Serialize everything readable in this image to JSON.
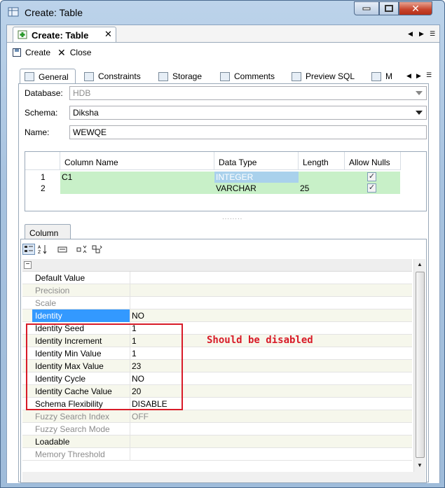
{
  "window": {
    "title": "Create: Table"
  },
  "editor_tab": {
    "label": "Create: Table",
    "close": "✕"
  },
  "toolbar": {
    "create_label": "Create",
    "close_label": "Close"
  },
  "subtabs": [
    "General",
    "Constraints",
    "Storage",
    "Comments",
    "Preview SQL",
    "M"
  ],
  "form": {
    "database_label": "Database:",
    "database_value": "HDB",
    "schema_label": "Schema:",
    "schema_value": "Diksha",
    "name_label": "Name:",
    "name_value": "WEWQE"
  },
  "columns_table": {
    "headers": [
      "Column Name",
      "Data Type",
      "Length",
      "Allow Nulls"
    ],
    "rows": [
      {
        "num": "1",
        "name": "C1",
        "type": "INTEGER",
        "length": "",
        "allow_nulls": true
      },
      {
        "num": "2",
        "name": "",
        "type": "VARCHAR",
        "length": "25",
        "allow_nulls": true
      }
    ]
  },
  "column_tab": {
    "label": "Column"
  },
  "properties": [
    {
      "name": "Default Value",
      "value": "",
      "disabled": false
    },
    {
      "name": "Precision",
      "value": "",
      "disabled": true
    },
    {
      "name": "Scale",
      "value": "",
      "disabled": true
    },
    {
      "name": "Identity",
      "value": "NO",
      "disabled": false,
      "selected": true
    },
    {
      "name": "Identity Seed",
      "value": "1",
      "disabled": false
    },
    {
      "name": "Identity Increment",
      "value": "1",
      "disabled": false
    },
    {
      "name": "Identity Min Value",
      "value": "1",
      "disabled": false
    },
    {
      "name": "Identity Max Value",
      "value": "23",
      "disabled": false
    },
    {
      "name": "Identity Cycle",
      "value": "NO",
      "disabled": false
    },
    {
      "name": "Identity Cache Value",
      "value": "20",
      "disabled": false
    },
    {
      "name": "Schema Flexibility",
      "value": "DISABLE",
      "disabled": false
    },
    {
      "name": "Fuzzy Search Index",
      "value": "OFF",
      "disabled": true
    },
    {
      "name": "Fuzzy Search Mode",
      "value": "",
      "disabled": true
    },
    {
      "name": "Loadable",
      "value": "",
      "disabled": false
    },
    {
      "name": "Memory Threshold",
      "value": "",
      "disabled": true
    }
  ],
  "annotation": {
    "text": "Should be disabled",
    "color": "#d81b28"
  },
  "colors": {
    "selection": "#3399ff",
    "row_highlight": "#c8f0c8"
  }
}
